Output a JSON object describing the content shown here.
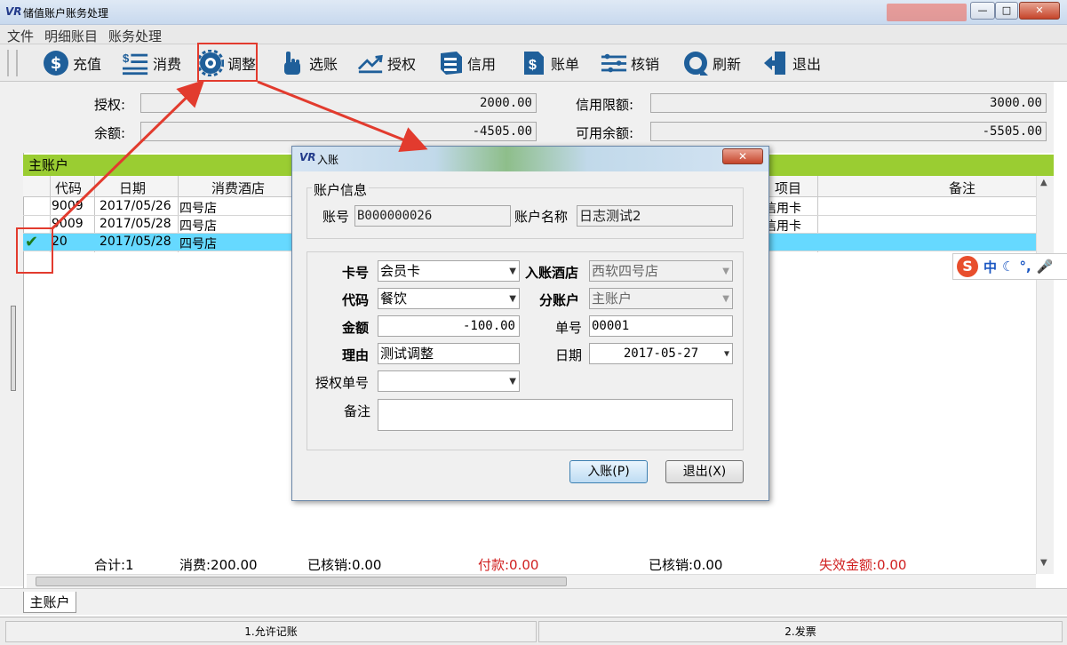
{
  "window": {
    "logo": "VR",
    "title": "储值账户账务处理",
    "btn_min": "—",
    "btn_max": "□",
    "btn_close": "✕"
  },
  "menu": [
    "文件",
    "明细账目",
    "账务处理"
  ],
  "toolbar": [
    {
      "label": "充值",
      "icon": "dollar-icon"
    },
    {
      "label": "消费",
      "icon": "list-dollar-icon"
    },
    {
      "label": "调整",
      "icon": "gear-icon"
    },
    {
      "label": "选账",
      "icon": "hand-pointer-icon"
    },
    {
      "label": "授权",
      "icon": "authorize-arrow-icon"
    },
    {
      "label": "信用",
      "icon": "credit-icon"
    },
    {
      "label": "账单",
      "icon": "bill-icon"
    },
    {
      "label": "核销",
      "icon": "writeoff-icon"
    },
    {
      "label": "刷新",
      "icon": "refresh-icon"
    },
    {
      "label": "退出",
      "icon": "exit-icon"
    }
  ],
  "info": {
    "auth_label": "授权:",
    "auth_value": "2000.00",
    "balance_label": "余额:",
    "balance_value": "-4505.00",
    "credit_label": "信用限额:",
    "credit_value": "3000.00",
    "avail_label": "可用余额:",
    "avail_value": "-5505.00"
  },
  "group_header": "主账户",
  "grid": {
    "headers": {
      "code": "代码",
      "date": "日期",
      "hotel": "消费酒店",
      "item": "项目",
      "remark": "备注"
    },
    "rows": [
      {
        "code": "9009",
        "date": "2017/05/26",
        "hotel": "四号店",
        "item": "信用卡",
        "checked": ""
      },
      {
        "code": "9009",
        "date": "2017/05/28",
        "hotel": "四号店",
        "item": "信用卡",
        "checked": ""
      },
      {
        "code": "20",
        "date": "2017/05/28",
        "hotel": "四号店",
        "item": "",
        "checked": "✔"
      }
    ]
  },
  "summary": {
    "count": "合计:1",
    "consume": "消费:200.00",
    "written1": "已核销:0.00",
    "paid": "付款:0.00",
    "written2": "已核销:0.00",
    "invalid": "失效金额:0.00"
  },
  "tab": "主账户",
  "status": {
    "left": "1.允许记账",
    "right": "2.发票"
  },
  "dialog": {
    "title": "入账",
    "close": "✕",
    "group_title": "账户信息",
    "acct_no_label": "账号",
    "acct_no": "B000000026",
    "acct_name_label": "账户名称",
    "acct_name": "日志测试2",
    "card_label": "卡号",
    "card_value": "会员卡",
    "hotel_label": "入账酒店",
    "hotel_value": "西软四号店",
    "code_label": "代码",
    "code_value": "餐饮",
    "subacct_label": "分账户",
    "subacct_value": "主账户",
    "amount_label": "金额",
    "amount_value": "-100.00",
    "billno_label": "单号",
    "billno_value": "00001",
    "reason_label": "理由",
    "reason_value": "测试调整",
    "date_label": "日期",
    "date_value": "2017-05-27",
    "authno_label": "授权单号",
    "authno_value": "",
    "remark_label": "备注",
    "remark_value": "",
    "ok_button": "入账(P)",
    "cancel_button": "退出(X)"
  },
  "ime": {
    "logo": "S",
    "mode": "中"
  }
}
